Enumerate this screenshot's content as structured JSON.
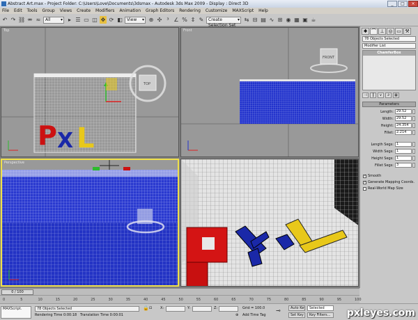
{
  "titlebar": {
    "title": "Abstract Art.max  - Project Folder: C:\\Users\\Love\\Documents\\3dsmax  - Autodesk 3ds Max  2009  - Display : Direct 3D"
  },
  "menu": [
    "File",
    "Edit",
    "Tools",
    "Group",
    "Views",
    "Create",
    "Modifiers",
    "Animation",
    "Graph Editors",
    "Rendering",
    "Customize",
    "MAXScript",
    "Help"
  ],
  "toolbar": {
    "filter": "All",
    "refcoord": "View",
    "selection_set": "Create Selection Set"
  },
  "viewports": {
    "top": "Top",
    "front": "Front",
    "perspective": "Perspective",
    "viewcube_top": "TOP",
    "viewcube_front": "FRONT"
  },
  "scene": {
    "letters": "PXL"
  },
  "cmdpanel": {
    "selection": "78 Objects Selected",
    "modifier_list": "Modifier List",
    "stack_item": "ChamferBox",
    "rollout": "Parameters",
    "params": [
      {
        "label": "Length:",
        "value": "29.52"
      },
      {
        "label": "Width:",
        "value": "29.52"
      },
      {
        "label": "Height:",
        "value": "24.354"
      },
      {
        "label": "Fillet:",
        "value": "2.214"
      }
    ],
    "segs": [
      {
        "label": "Length Segs:",
        "value": "1"
      },
      {
        "label": "Width Segs:",
        "value": "1"
      },
      {
        "label": "Height Segs:",
        "value": "1"
      },
      {
        "label": "Fillet Segs:",
        "value": "3"
      }
    ],
    "checks": [
      {
        "label": "Smooth",
        "checked": true
      },
      {
        "label": "Generate Mapping Coords.",
        "checked": true
      },
      {
        "label": "Real-World Map Size",
        "checked": false
      }
    ]
  },
  "timeline": {
    "slider": "0 / 100",
    "ticks": [
      "0",
      "5",
      "10",
      "15",
      "20",
      "25",
      "30",
      "35",
      "40",
      "45",
      "50",
      "55",
      "60",
      "65",
      "70",
      "75",
      "80",
      "85",
      "90",
      "95",
      "100"
    ]
  },
  "status": {
    "script": "MAXScript.",
    "selected": "78 Objects Selected",
    "render_time": "Rendering Time  0:00:18",
    "translation_time": "Translation Time  0:00:01",
    "x_label": "X:",
    "y_label": "Y:",
    "z_label": "Z:",
    "grid": "Grid = 100.0",
    "add_time_tag": "Add Time Tag",
    "auto_key": "Auto Key",
    "set_key": "Set Key",
    "selected_set": "Selected",
    "key_filters": "Key Filters..."
  },
  "watermark": "pxleyes.com",
  "colors": {
    "viewport_bg": "#999999",
    "active_border": "#f0e14a",
    "blue_grid": "#2233cc",
    "red": "#cc1111",
    "yellow": "#e8c81a"
  }
}
